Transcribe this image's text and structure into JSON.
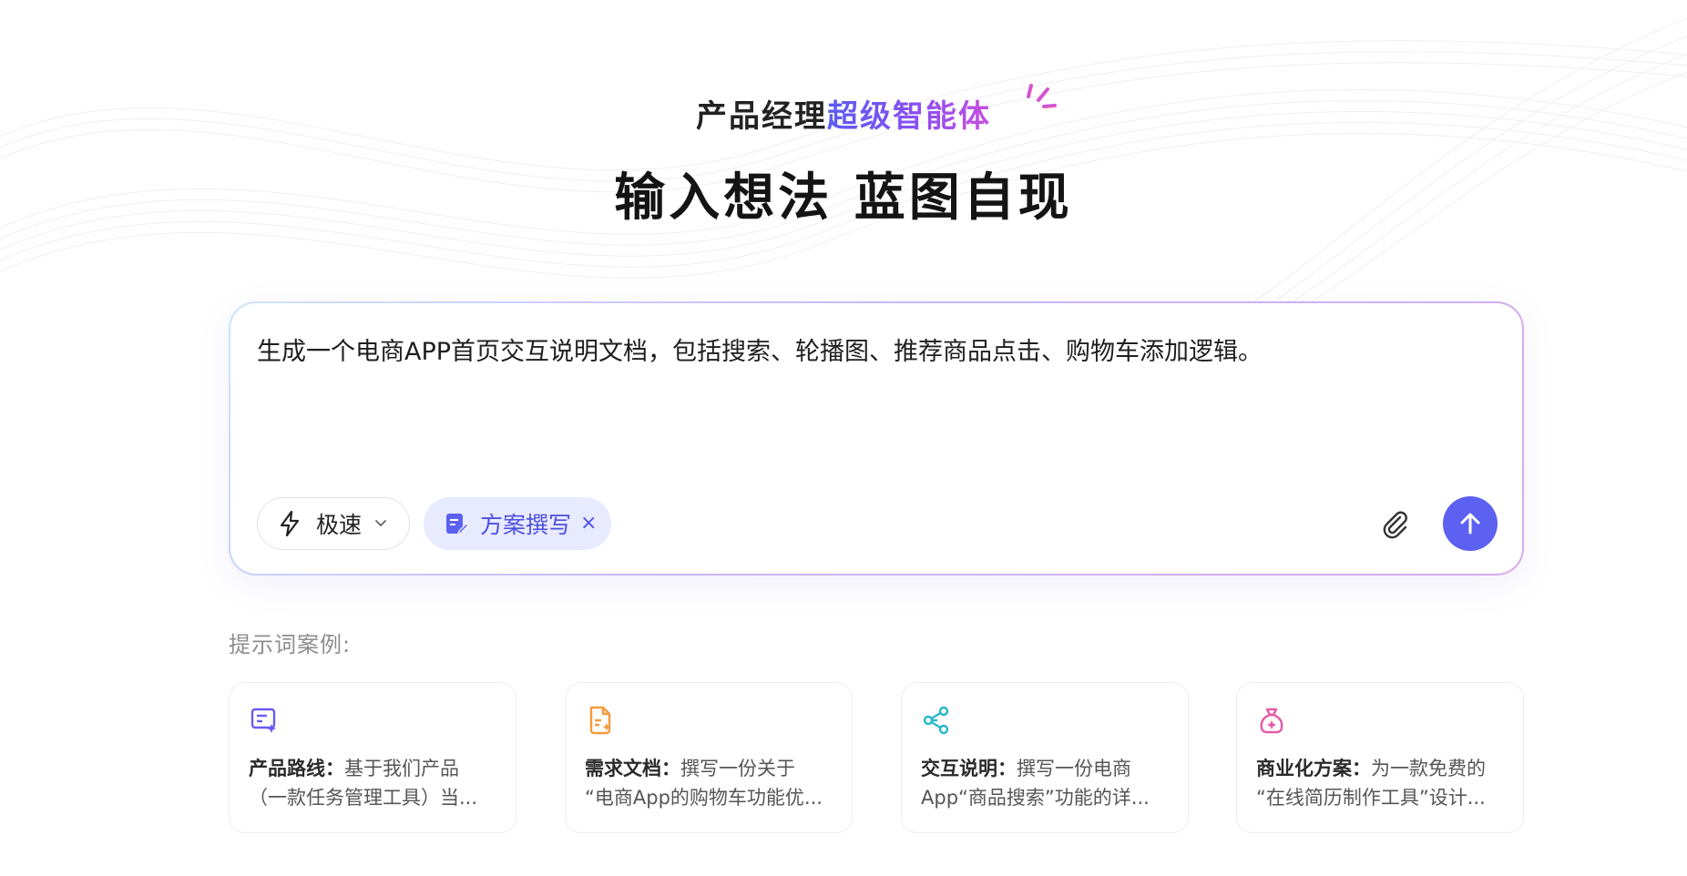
{
  "hero": {
    "subtitle_plain": "产品经理",
    "subtitle_accent": "超级智能体",
    "title": "输入想法 蓝图自现"
  },
  "composer": {
    "prompt_text": "生成一个电商APP首页交互说明文档，包括搜索、轮播图、推荐商品点击、购物车添加逻辑。",
    "mode_label": "极速",
    "mode_icon": "lightning-icon",
    "tag_label": "方案撰写",
    "tag_close": "×",
    "attach_icon": "paperclip-icon",
    "send_icon": "arrow-up-icon",
    "send_color": "#5c61f2"
  },
  "examples": {
    "label": "提示词案例:",
    "cards": [
      {
        "icon": "roadmap-icon",
        "title": "产品路线：",
        "line1": "基于我们产品",
        "line2": "（一款任务管理工具）当..."
      },
      {
        "icon": "document-icon",
        "title": "需求文档：",
        "line1": "撰写一份关于",
        "line2": "“电商App的购物车功能优..."
      },
      {
        "icon": "share-nodes-icon",
        "title": "交互说明：",
        "line1": "撰写一份电商",
        "line2": "App“商品搜索”功能的详..."
      },
      {
        "icon": "money-bag-icon",
        "title": "商业化方案：",
        "line1": "为一款免费的",
        "line2": "“在线简历制作工具”设计..."
      }
    ]
  },
  "colors": {
    "accent": "#5c61f2",
    "tag_bg": "#e8eaff",
    "card_icon_1": "#6a5cf0",
    "card_icon_2": "#f39a3c",
    "card_icon_3": "#27b7c9",
    "card_icon_4": "#e85aa8"
  }
}
